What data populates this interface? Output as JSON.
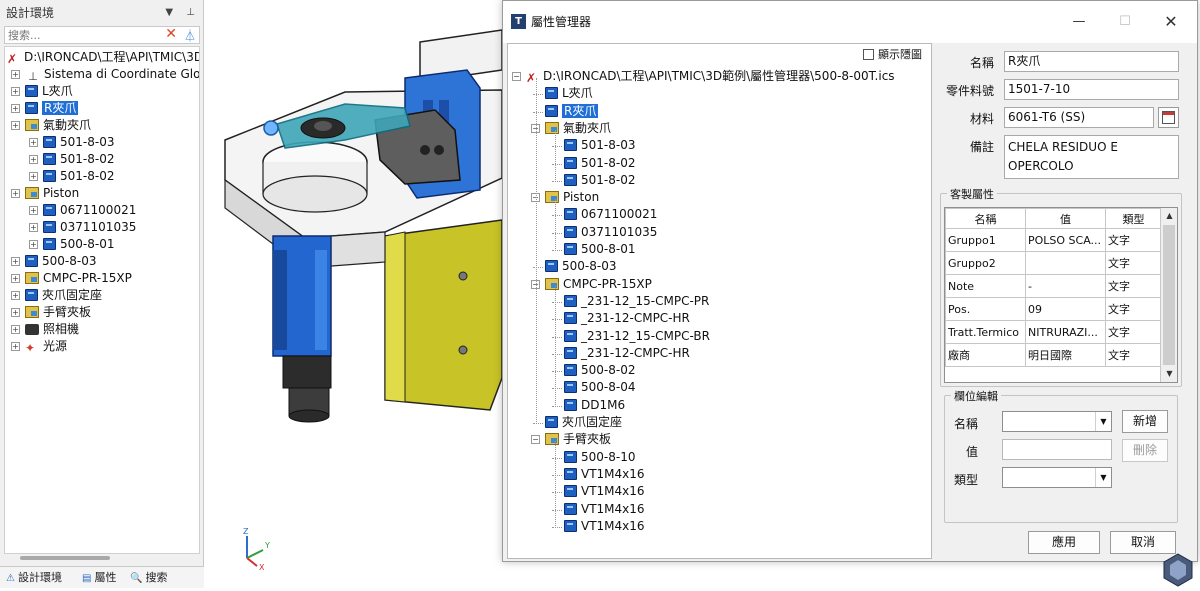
{
  "left_panel": {
    "title": "設計環境",
    "search_placeholder": "搜索...",
    "tree": [
      {
        "label": "D:\\IRONCAD\\工程\\API\\TMIC\\3D",
        "icon": "root-assembly-icon"
      },
      {
        "label": "Sistema di Coordinate Globa",
        "icon": "coordinate-system-icon"
      },
      {
        "label": "L夾爪",
        "icon": "part-icon"
      },
      {
        "label": "R夾爪",
        "icon": "part-icon",
        "selected": true
      },
      {
        "label": "氣動夾爪",
        "icon": "assembly-icon"
      },
      {
        "label": "501-8-03",
        "icon": "part-icon"
      },
      {
        "label": "501-8-02",
        "icon": "part-icon"
      },
      {
        "label": "501-8-02",
        "icon": "part-icon"
      },
      {
        "label": "Piston",
        "icon": "assembly-icon"
      },
      {
        "label": "0671100021",
        "icon": "part-icon"
      },
      {
        "label": "0371101035",
        "icon": "part-icon"
      },
      {
        "label": "500-8-01",
        "icon": "part-icon"
      },
      {
        "label": "500-8-03",
        "icon": "part-icon"
      },
      {
        "label": "CMPC-PR-15XP",
        "icon": "assembly-icon"
      },
      {
        "label": "夾爪固定座",
        "icon": "part-icon"
      },
      {
        "label": "手臂夾板",
        "icon": "assembly-icon"
      },
      {
        "label": "照相機",
        "icon": "camera-icon"
      },
      {
        "label": "光源",
        "icon": "light-icon"
      }
    ],
    "tabs": [
      {
        "label": "設計環境",
        "icon": "scene-icon"
      },
      {
        "label": "屬性",
        "icon": "properties-icon"
      },
      {
        "label": "搜索",
        "icon": "search-icon"
      }
    ]
  },
  "viewport": {
    "axis_labels": {
      "z": "Z",
      "y": "Y",
      "x": "X"
    }
  },
  "dialog": {
    "title": "屬性管理器",
    "show_hidden_label": "顯示隱圖",
    "tree": [
      {
        "label": "D:\\IRONCAD\\工程\\API\\TMIC\\3D範例\\屬性管理器\\500-8-00T.ics",
        "icon": "root-assembly-icon"
      },
      {
        "label": "L夾爪",
        "icon": "part-icon"
      },
      {
        "label": "R夾爪",
        "icon": "part-icon",
        "selected": true
      },
      {
        "label": "氣動夾爪",
        "icon": "assembly-icon"
      },
      {
        "label": "501-8-03",
        "icon": "part-icon"
      },
      {
        "label": "501-8-02",
        "icon": "part-icon"
      },
      {
        "label": "501-8-02",
        "icon": "part-icon"
      },
      {
        "label": "Piston",
        "icon": "assembly-icon"
      },
      {
        "label": "0671100021",
        "icon": "part-icon"
      },
      {
        "label": "0371101035",
        "icon": "part-icon"
      },
      {
        "label": "500-8-01",
        "icon": "part-icon"
      },
      {
        "label": "500-8-03",
        "icon": "part-icon"
      },
      {
        "label": "CMPC-PR-15XP",
        "icon": "assembly-icon"
      },
      {
        "label": "_231-12_15-CMPC-PR",
        "icon": "part-icon"
      },
      {
        "label": "_231-12-CMPC-HR",
        "icon": "part-icon"
      },
      {
        "label": "_231-12_15-CMPC-BR",
        "icon": "part-icon"
      },
      {
        "label": "_231-12-CMPC-HR",
        "icon": "part-icon"
      },
      {
        "label": "500-8-02",
        "icon": "part-icon"
      },
      {
        "label": "500-8-04",
        "icon": "part-icon"
      },
      {
        "label": "DD1M6",
        "icon": "part-icon"
      },
      {
        "label": "夾爪固定座",
        "icon": "part-icon"
      },
      {
        "label": "手臂夾板",
        "icon": "assembly-icon"
      },
      {
        "label": "500-8-10",
        "icon": "part-icon"
      },
      {
        "label": "VT1M4x16",
        "icon": "part-icon"
      },
      {
        "label": "VT1M4x16",
        "icon": "part-icon"
      },
      {
        "label": "VT1M4x16",
        "icon": "part-icon"
      },
      {
        "label": "VT1M4x16",
        "icon": "part-icon"
      }
    ],
    "props": {
      "name_label": "名稱",
      "name_value": "R夾爪",
      "part_no_label": "零件料號",
      "part_no_value": "1501-7-10",
      "material_label": "材料",
      "material_value": "6061-T6 (SS)",
      "remark_label": "備註",
      "remark_value": "CHELA RESIDUO E OPERCOLO",
      "custom_group_title": "客製屬性",
      "table_headers": [
        "名稱",
        "值",
        "類型"
      ],
      "table_rows": [
        [
          "Gruppo1",
          "POLSO SCA...",
          "文字"
        ],
        [
          "Gruppo2",
          "",
          "文字"
        ],
        [
          "Note",
          "-",
          "文字"
        ],
        [
          "Pos.",
          "09",
          "文字"
        ],
        [
          "Tratt.Termico",
          "NITRURAZI...",
          "文字"
        ],
        [
          "廠商",
          "明日國際",
          "文字"
        ]
      ],
      "edit_group_title": "欄位編輯",
      "edit_name_label": "名稱",
      "edit_value_label": "值",
      "edit_type_label": "類型",
      "add_button": "新增",
      "delete_button": "刪除",
      "apply_button": "應用",
      "cancel_button": "取消"
    }
  }
}
